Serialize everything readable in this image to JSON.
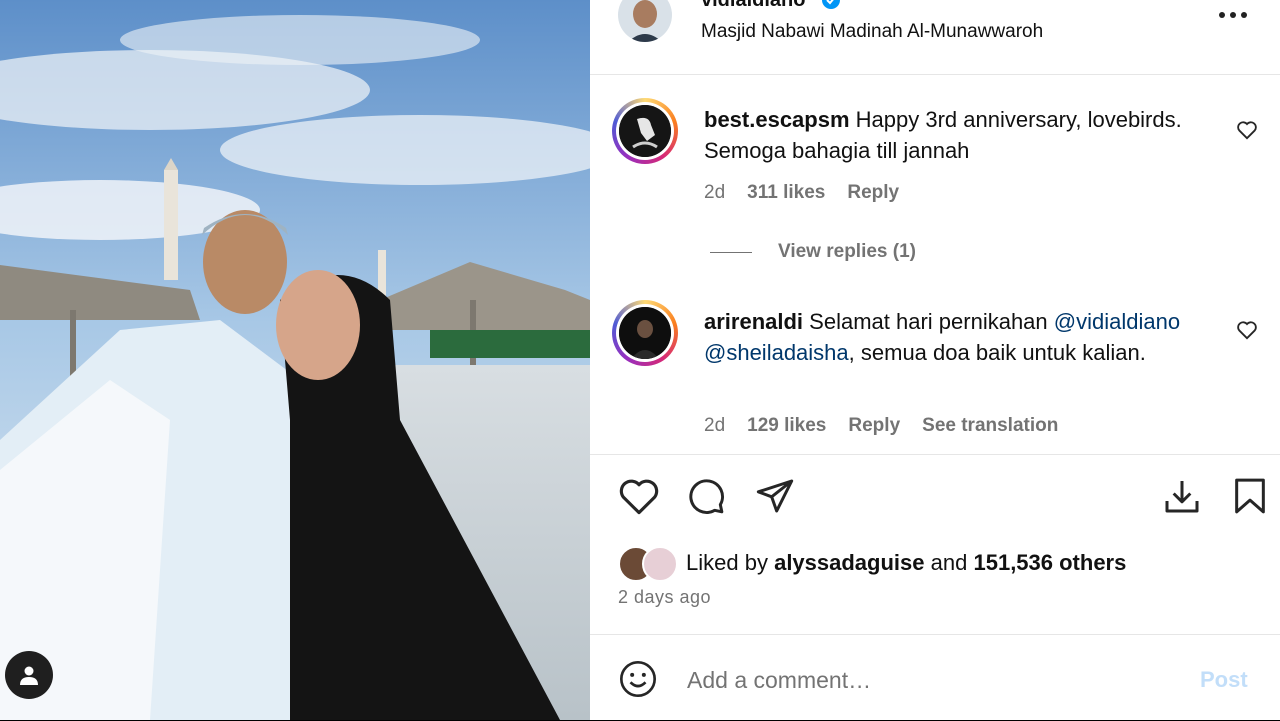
{
  "post": {
    "author": {
      "username": "vidialdiano",
      "verified": true,
      "location": "Masjid Nabawi Madinah Al-Munawwaroh"
    },
    "more_icon": "more-horizontal-icon"
  },
  "comments": [
    {
      "username": "best.escapsm",
      "text": "Happy 3rd anniversary, lovebirds. Semoga bahagia till jannah",
      "time": "2d",
      "likes": "311 likes",
      "reply_label": "Reply",
      "view_replies": "View replies (1)"
    },
    {
      "username": "arirenaldi",
      "text_before": "Selamat hari pernikahan",
      "mention1": "@vidialdiano",
      "mention2": "@sheiladaisha",
      "text_after": ", semua doa baik untuk kalian.",
      "time": "2d",
      "likes": "129 likes",
      "reply_label": "Reply",
      "translation_label": "See translation"
    }
  ],
  "actions": [
    "heart-icon",
    "comment-icon",
    "share-icon",
    "download-icon",
    "bookmark-icon"
  ],
  "likes": {
    "prefix": "Liked by",
    "user": "alyssadaguise",
    "middle": "and",
    "others": "151,536 others"
  },
  "timestamp": "2 days ago",
  "add_comment": {
    "placeholder": "Add a comment…",
    "post_label": "Post"
  },
  "colors": {
    "link": "#00376b",
    "muted": "#737373",
    "post_disabled": "#c2def9"
  }
}
